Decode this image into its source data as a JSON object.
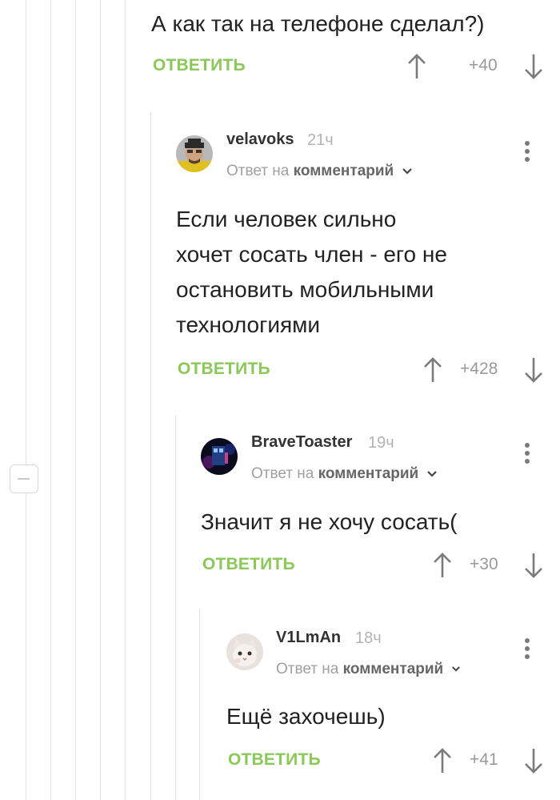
{
  "parent_comment": {
    "text": "А как так на телефоне сделал?)",
    "reply_label": "ОТВЕТИТЬ",
    "score": "+40"
  },
  "comments": [
    {
      "username": "velavoks",
      "time": "21ч",
      "reply_to_prefix": "Ответ на",
      "reply_to_link": "комментарий",
      "text_lines": [
        "Если человек сильно",
        "хочет сосать член - его не",
        "остановить мобильными",
        "технологиями"
      ],
      "reply_label": "ОТВЕТИТЬ",
      "score": "+428"
    },
    {
      "username": "BraveToaster",
      "time": "19ч",
      "reply_to_prefix": "Ответ на",
      "reply_to_link": "комментарий",
      "text_lines": [
        "Значит я не хочу сосать("
      ],
      "reply_label": "ОТВЕТИТЬ",
      "score": "+30"
    },
    {
      "username": "V1LmAn",
      "time": "18ч",
      "reply_to_prefix": "Ответ на",
      "reply_to_link": "комментарий",
      "text_lines": [
        "Ещё захочешь)"
      ],
      "reply_label": "ОТВЕТИТЬ",
      "score": "+41"
    }
  ],
  "colors": {
    "reply_green": "#8ac858",
    "thread_line": "#e3e3e3",
    "text": "#222222",
    "muted": "#a0a0a0"
  },
  "icons": {
    "upvote": "arrow-up-icon",
    "downvote": "arrow-down-icon",
    "more": "more-vertical-icon",
    "collapse": "minus-icon",
    "expand_reply": "chevron-down-icon"
  }
}
